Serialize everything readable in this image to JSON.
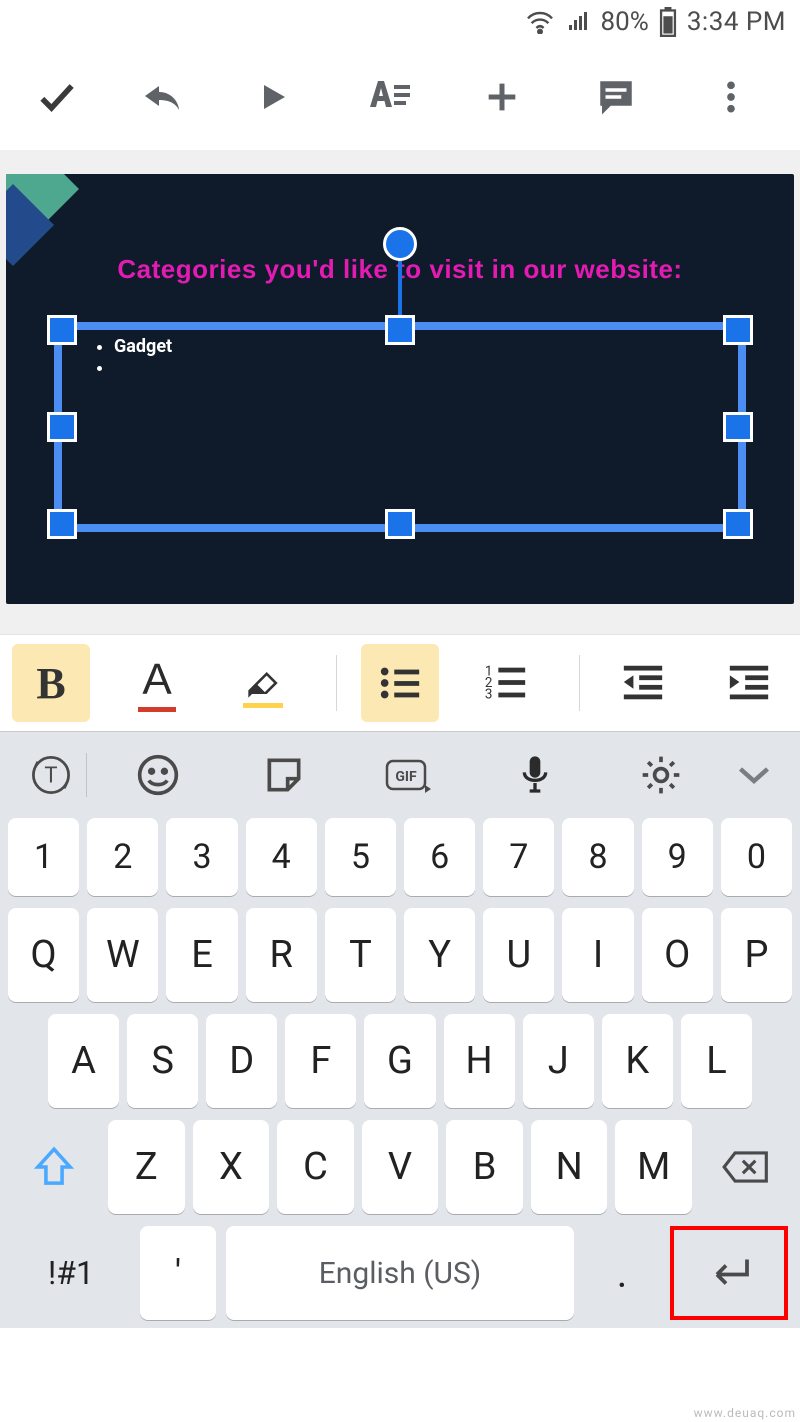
{
  "status": {
    "battery": "80%",
    "time": "3:34 PM"
  },
  "toolbar": {
    "done": "Done",
    "undo": "Undo",
    "present": "Present",
    "textformat": "Text format",
    "add": "Add",
    "comment": "Comment",
    "overflow": "More"
  },
  "slide": {
    "title": "Categories you'd like to visit in our website:",
    "bullets": [
      "Gadget",
      ""
    ]
  },
  "formatbar": {
    "bold": "B",
    "text_color": "A"
  },
  "keyboard": {
    "rows": {
      "numbers": [
        "1",
        "2",
        "3",
        "4",
        "5",
        "6",
        "7",
        "8",
        "9",
        "0"
      ],
      "r1": [
        "Q",
        "W",
        "E",
        "R",
        "T",
        "Y",
        "U",
        "I",
        "O",
        "P"
      ],
      "r2": [
        "A",
        "S",
        "D",
        "F",
        "G",
        "H",
        "J",
        "K",
        "L"
      ],
      "r3": [
        "Z",
        "X",
        "C",
        "V",
        "B",
        "N",
        "M"
      ]
    },
    "sym": "!#1",
    "apostrophe": "'",
    "space": "English (US)",
    "dot": "."
  },
  "watermark": "www.deuaq.com"
}
